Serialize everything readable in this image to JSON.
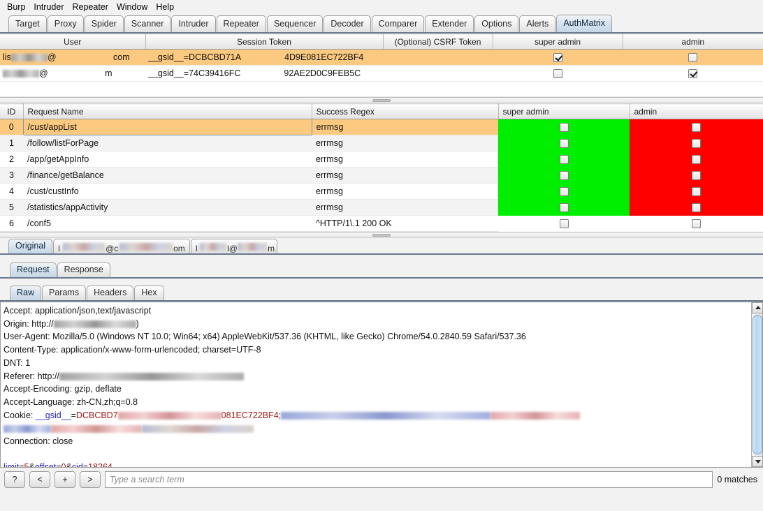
{
  "menu": {
    "items": [
      "Burp",
      "Intruder",
      "Repeater",
      "Window",
      "Help"
    ]
  },
  "main_tabs": {
    "items": [
      "Target",
      "Proxy",
      "Spider",
      "Scanner",
      "Intruder",
      "Repeater",
      "Sequencer",
      "Decoder",
      "Comparer",
      "Extender",
      "Options",
      "Alerts",
      "AuthMatrix"
    ],
    "active": "AuthMatrix"
  },
  "user_table": {
    "columns": [
      "User",
      "Session Token",
      "(Optional) CSRF Token",
      "super admin",
      "admin"
    ],
    "rows": [
      {
        "user_prefix": "lis",
        "user_suffix": "com",
        "token": "__gsid__=DCBCBD71A",
        "token_tail": "4D9E081EC722BF4",
        "csrf": "",
        "super_admin": true,
        "admin": false,
        "selected": true
      },
      {
        "user_prefix": "",
        "user_suffix": "m",
        "token": "__gsid__=74C39416FC",
        "token_tail": "92AE2D0C9FEB5C",
        "csrf": "",
        "super_admin": false,
        "admin": true,
        "selected": false
      }
    ]
  },
  "request_table": {
    "columns": [
      "ID",
      "Request Name",
      "Success Regex",
      "super admin",
      "admin"
    ],
    "rows": [
      {
        "id": "0",
        "name": "/cust/appList",
        "regex": "errmsg",
        "super_admin_state": "pass",
        "admin_state": "fail",
        "super_admin_checked": false,
        "admin_checked": false,
        "selected": true
      },
      {
        "id": "1",
        "name": "/follow/listForPage",
        "regex": "errmsg",
        "super_admin_state": "pass",
        "admin_state": "fail",
        "super_admin_checked": false,
        "admin_checked": false,
        "selected": false
      },
      {
        "id": "2",
        "name": "/app/getAppInfo",
        "regex": "errmsg",
        "super_admin_state": "pass",
        "admin_state": "fail",
        "super_admin_checked": false,
        "admin_checked": false,
        "selected": false
      },
      {
        "id": "3",
        "name": "/finance/getBalance",
        "regex": "errmsg",
        "super_admin_state": "pass",
        "admin_state": "fail",
        "super_admin_checked": false,
        "admin_checked": false,
        "selected": false
      },
      {
        "id": "4",
        "name": "/cust/custInfo",
        "regex": "errmsg",
        "super_admin_state": "pass",
        "admin_state": "fail",
        "super_admin_checked": false,
        "admin_checked": false,
        "selected": false
      },
      {
        "id": "5",
        "name": "/statistics/appActivity",
        "regex": "errmsg",
        "super_admin_state": "pass",
        "admin_state": "fail",
        "super_admin_checked": false,
        "admin_checked": false,
        "selected": false
      },
      {
        "id": "6",
        "name": "/conf5",
        "regex": "^HTTP/1\\.1 200 OK",
        "super_admin_state": "none",
        "admin_state": "none",
        "super_admin_checked": false,
        "admin_checked": false,
        "selected": false
      }
    ],
    "colors": {
      "pass": "#00ee00",
      "fail": "#fe0000",
      "none": "#ffffff"
    }
  },
  "user_tabs": {
    "items": [
      "Original",
      "<redacted-email-1>",
      "<redacted-email-2>"
    ],
    "active": "Original"
  },
  "message_tabs": {
    "items": [
      "Request",
      "Response"
    ],
    "active": "Request"
  },
  "view_tabs": {
    "items": [
      "Raw",
      "Params",
      "Headers",
      "Hex"
    ],
    "active": "Raw"
  },
  "raw_request": {
    "lines": [
      {
        "type": "plain",
        "text": "Accept: application/json,text/javascript"
      },
      {
        "type": "redacted_origin",
        "prefix": "Origin: http://",
        "tail": ")"
      },
      {
        "type": "plain",
        "text": "User-Agent: Mozilla/5.0 (Windows NT 10.0; Win64; x64) AppleWebKit/537.36 (KHTML, like Gecko) Chrome/54.0.2840.59 Safari/537.36"
      },
      {
        "type": "plain",
        "text": "Content-Type: application/x-www-form-urlencoded; charset=UTF-8"
      },
      {
        "type": "plain",
        "text": "DNT: 1"
      },
      {
        "type": "redacted_referer",
        "prefix": "Referer: http://"
      },
      {
        "type": "plain",
        "text": "Accept-Encoding: gzip, deflate"
      },
      {
        "type": "plain",
        "text": "Accept-Language: zh-CN,zh;q=0.8"
      },
      {
        "type": "cookie",
        "prefix": "Cookie: ",
        "key": "__gsid__",
        "eq": "=",
        "value_head": "DCBCBD7",
        "value_tail": "081EC722BF4;"
      },
      {
        "type": "redacted_cookie2",
        "text": ""
      },
      {
        "type": "plain",
        "text": "Connection: close"
      },
      {
        "type": "plain",
        "text": ""
      },
      {
        "type": "body",
        "parts": [
          {
            "t": "limit",
            "c": "blue"
          },
          {
            "t": "=",
            "c": "dark"
          },
          {
            "t": "5",
            "c": "red"
          },
          {
            "t": "&",
            "c": "dark"
          },
          {
            "t": "offset",
            "c": "blue"
          },
          {
            "t": "=",
            "c": "dark"
          },
          {
            "t": "0",
            "c": "red"
          },
          {
            "t": "&",
            "c": "dark"
          },
          {
            "t": "cid",
            "c": "blue"
          },
          {
            "t": "=",
            "c": "dark"
          },
          {
            "t": "18264",
            "c": "red"
          }
        ]
      }
    ]
  },
  "search_bar": {
    "help_label": "?",
    "prev_label": "<",
    "add_label": "+",
    "next_label": ">",
    "placeholder": "Type a search term",
    "value": "",
    "matches": "0 matches"
  },
  "colors": {
    "selection": "#fbc97f",
    "pass": "#00ee00",
    "fail": "#fe0000",
    "tab_active": "#c7d7e6",
    "accent_blue": "#2424c8",
    "accent_red": "#a01818"
  }
}
